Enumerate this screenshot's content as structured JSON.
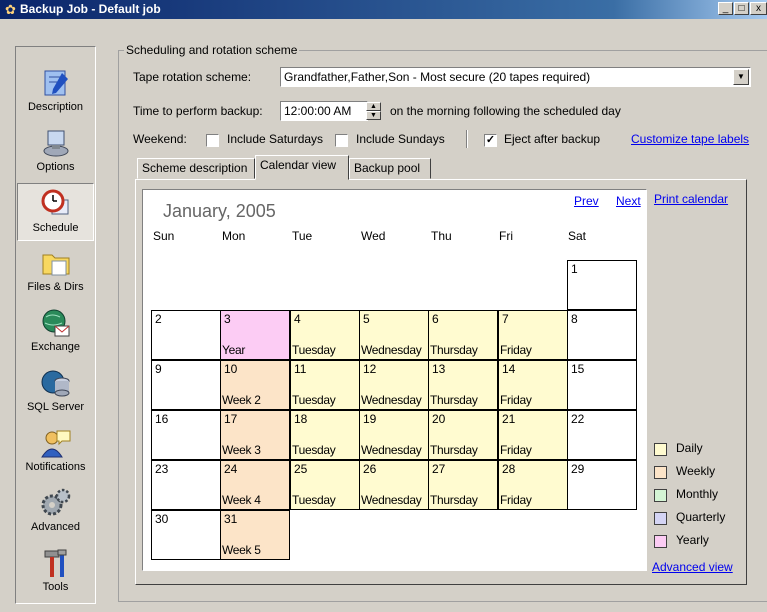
{
  "window": {
    "title": "Backup Job - Default job",
    "btn_min": "_",
    "btn_max": "□",
    "btn_close": "x"
  },
  "sidebar": {
    "items": [
      {
        "label": "Description"
      },
      {
        "label": "Options"
      },
      {
        "label": "Schedule"
      },
      {
        "label": "Files & Dirs"
      },
      {
        "label": "Exchange"
      },
      {
        "label": "SQL Server"
      },
      {
        "label": "Notifications"
      },
      {
        "label": "Advanced"
      },
      {
        "label": "Tools"
      }
    ]
  },
  "scheme": {
    "group_label": "Scheduling and rotation scheme",
    "rotation_label": "Tape rotation scheme:",
    "rotation_value": "Grandfather,Father,Son - Most secure (20 tapes required)",
    "time_label": "Time to perform backup:",
    "time_value": "12:00:00 AM",
    "time_suffix": "on the morning following the scheduled day",
    "weekend_label": "Weekend:",
    "include_saturdays": "Include Saturdays",
    "include_sundays": "Include Sundays",
    "eject_label": "Eject after backup",
    "eject_check": "✓",
    "customize_link": "Customize tape labels"
  },
  "tabs": [
    {
      "label": "Scheme description"
    },
    {
      "label": "Calendar view"
    },
    {
      "label": "Backup pool"
    }
  ],
  "calendar": {
    "month": "January, 2005",
    "prev": "Prev",
    "next": "Next",
    "print": "Print calendar",
    "advanced": "Advanced view",
    "days": [
      "Sun",
      "Mon",
      "Tue",
      "Wed",
      "Thu",
      "Fri",
      "Sat"
    ],
    "colors": {
      "daily": "#fffbd0",
      "weekly": "#fce4c8",
      "monthly": "#d4f4d4",
      "quarterly": "#d4d4f4",
      "yearly": "#fcccf4"
    },
    "cells": [
      {
        "row": 0,
        "col": 6,
        "n": "1",
        "t": "",
        "c": ""
      },
      {
        "row": 1,
        "col": 0,
        "n": "2",
        "t": "",
        "c": ""
      },
      {
        "row": 1,
        "col": 1,
        "n": "3",
        "t": "Year",
        "c": "yearly"
      },
      {
        "row": 1,
        "col": 2,
        "n": "4",
        "t": "Tuesday",
        "c": "daily"
      },
      {
        "row": 1,
        "col": 3,
        "n": "5",
        "t": "Wednesday",
        "c": "daily"
      },
      {
        "row": 1,
        "col": 4,
        "n": "6",
        "t": "Thursday",
        "c": "daily"
      },
      {
        "row": 1,
        "col": 5,
        "n": "7",
        "t": "Friday",
        "c": "daily"
      },
      {
        "row": 1,
        "col": 6,
        "n": "8",
        "t": "",
        "c": ""
      },
      {
        "row": 2,
        "col": 0,
        "n": "9",
        "t": "",
        "c": ""
      },
      {
        "row": 2,
        "col": 1,
        "n": "10",
        "t": "Week 2",
        "c": "weekly"
      },
      {
        "row": 2,
        "col": 2,
        "n": "11",
        "t": "Tuesday",
        "c": "daily"
      },
      {
        "row": 2,
        "col": 3,
        "n": "12",
        "t": "Wednesday",
        "c": "daily"
      },
      {
        "row": 2,
        "col": 4,
        "n": "13",
        "t": "Thursday",
        "c": "daily"
      },
      {
        "row": 2,
        "col": 5,
        "n": "14",
        "t": "Friday",
        "c": "daily"
      },
      {
        "row": 2,
        "col": 6,
        "n": "15",
        "t": "",
        "c": ""
      },
      {
        "row": 3,
        "col": 0,
        "n": "16",
        "t": "",
        "c": ""
      },
      {
        "row": 3,
        "col": 1,
        "n": "17",
        "t": "Week 3",
        "c": "weekly"
      },
      {
        "row": 3,
        "col": 2,
        "n": "18",
        "t": "Tuesday",
        "c": "daily"
      },
      {
        "row": 3,
        "col": 3,
        "n": "19",
        "t": "Wednesday",
        "c": "daily"
      },
      {
        "row": 3,
        "col": 4,
        "n": "20",
        "t": "Thursday",
        "c": "daily"
      },
      {
        "row": 3,
        "col": 5,
        "n": "21",
        "t": "Friday",
        "c": "daily"
      },
      {
        "row": 3,
        "col": 6,
        "n": "22",
        "t": "",
        "c": ""
      },
      {
        "row": 4,
        "col": 0,
        "n": "23",
        "t": "",
        "c": ""
      },
      {
        "row": 4,
        "col": 1,
        "n": "24",
        "t": "Week 4",
        "c": "weekly"
      },
      {
        "row": 4,
        "col": 2,
        "n": "25",
        "t": "Tuesday",
        "c": "daily"
      },
      {
        "row": 4,
        "col": 3,
        "n": "26",
        "t": "Wednesday",
        "c": "daily"
      },
      {
        "row": 4,
        "col": 4,
        "n": "27",
        "t": "Thursday",
        "c": "daily"
      },
      {
        "row": 4,
        "col": 5,
        "n": "28",
        "t": "Friday",
        "c": "daily"
      },
      {
        "row": 4,
        "col": 6,
        "n": "29",
        "t": "",
        "c": ""
      },
      {
        "row": 5,
        "col": 0,
        "n": "30",
        "t": "",
        "c": ""
      },
      {
        "row": 5,
        "col": 1,
        "n": "31",
        "t": "Week 5",
        "c": "weekly"
      }
    ],
    "legend": [
      {
        "label": "Daily",
        "c": "daily"
      },
      {
        "label": "Weekly",
        "c": "weekly"
      },
      {
        "label": "Monthly",
        "c": "monthly"
      },
      {
        "label": "Quarterly",
        "c": "quarterly"
      },
      {
        "label": "Yearly",
        "c": "yearly"
      }
    ]
  }
}
